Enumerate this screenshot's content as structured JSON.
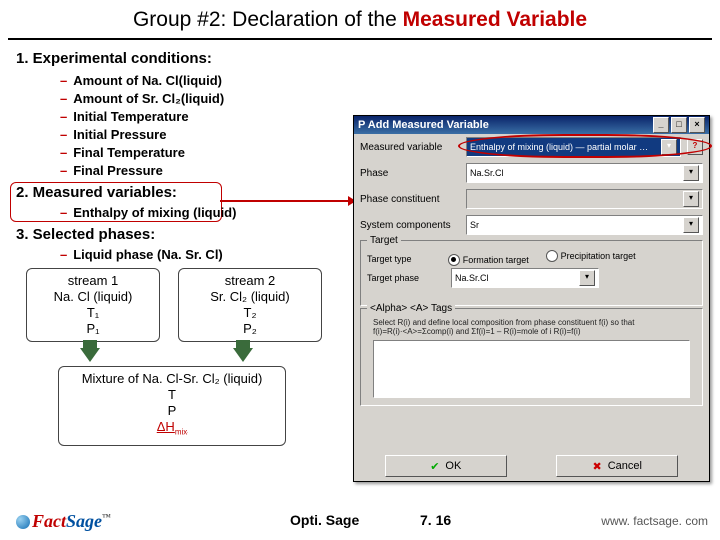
{
  "title": {
    "pre": "Group #2: Declaration of the ",
    "kw1": "Measured",
    "mid": " ",
    "kw2": "Variable"
  },
  "s1": "1. Experimental conditions:",
  "b1": [
    "Amount of Na. Cl(liquid)",
    "Amount of Sr. Cl₂(liquid)",
    "Initial Temperature",
    "Initial Pressure",
    "Final Temperature",
    "Final Pressure"
  ],
  "s2": "2. Measured variables:",
  "b2": "Enthalpy of mixing (liquid)",
  "s3": "3. Selected phases:",
  "b3": "Liquid phase (Na. Sr. Cl)",
  "stream1": {
    "t": "stream 1",
    "c": "Na. Cl (liquid)",
    "tv": "T₁",
    "pv": "P₁"
  },
  "stream2": {
    "t": "stream 2",
    "c": "Sr. Cl₂ (liquid)",
    "tv": "T₂",
    "pv": "P₂"
  },
  "mix": {
    "t": "Mixture of Na. Cl-Sr. Cl₂ (liquid)",
    "tv": "T",
    "pv": "P",
    "dh": "ΔH",
    "dhsub": "mix"
  },
  "foot": {
    "app": "Opti. Sage",
    "page": "7. 16",
    "url": "www. factsage. com"
  },
  "logo": {
    "a": "Fact",
    "b": "Sage"
  },
  "dlg": {
    "title": "P Add Measured Variable",
    "labels": {
      "mv": "Measured variable",
      "ph": "Phase",
      "pc": "Phase constituent",
      "sc": "System components"
    },
    "mv_val": "Enthalpy of mixing (liquid) — partial molar …",
    "ph_val": "Na.Sr.Cl",
    "pc_val": "",
    "sc_val": "Sr",
    "target": {
      "t": "Target",
      "r1": "Target type",
      "o1": "Formation target",
      "o2": "Precipitation target",
      "r2": "Target phase",
      "tp": "Na.Sr.Cl"
    },
    "alpha": {
      "t": "<Alpha> <A> Tags",
      "note": "Select R(i) and define local composition from phase constituent f(i) so that f(i)=R(i)·<A>=Σcomp(i) and Σf(i)=1 – R(i)=mole of i  R(i)=f(i)"
    },
    "ok": "OK",
    "cancel": "Cancel"
  }
}
